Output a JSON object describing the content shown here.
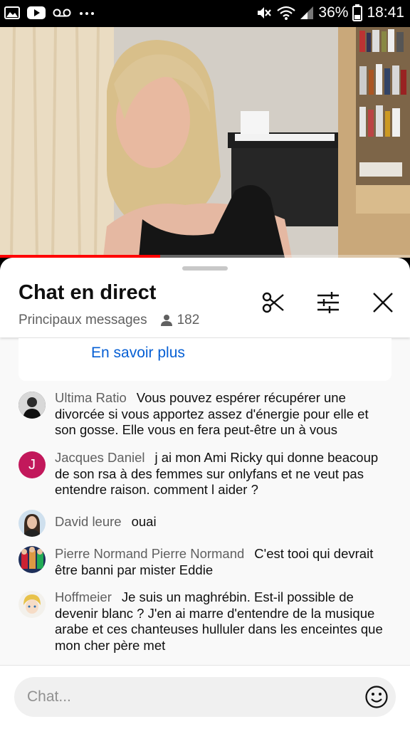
{
  "status_bar": {
    "left_icons": [
      "gallery-icon",
      "youtube-icon",
      "voicemail-icon",
      "more-dots-icon"
    ],
    "battery": "36%",
    "time": "18:41"
  },
  "video": {
    "progress_fraction": 0.39
  },
  "chat": {
    "title": "Chat en direct",
    "mode": "Principaux messages",
    "viewers": "182",
    "info_link": "En savoir plus",
    "input_placeholder": "Chat..."
  },
  "messages": [
    {
      "author": "Ultima Ratio",
      "text": "Vous pouvez espérer récupérer une divorcée si vous apportez assez d'énergie pour elle et son gosse. Elle vous en fera peut-être un à vous",
      "avatar": "photo"
    },
    {
      "author": "Jacques Daniel",
      "text": "j ai mon Ami Ricky qui donne beacoup de son rsa à des femmes sur onlyfans et ne veut pas entendre raison. comment l aider ?",
      "avatar_letter": "J",
      "avatar_color": "#c2185b"
    },
    {
      "author": "David leure",
      "text": "ouai",
      "avatar": "photo"
    },
    {
      "author": "Pierre Normand Pierre Normand",
      "text": "C'est tooi qui devrait être banni par mister Eddie",
      "avatar": "photo"
    },
    {
      "author": "Hoffmeier",
      "text": "Je suis un maghrébin. Est-il possible de devenir blanc ? J'en ai marre d'entendre de la musique arabe et ces chanteuses hulluler dans les enceintes que mon cher père met",
      "avatar": "photo"
    }
  ],
  "colors": {
    "accent_link": "#065fd4",
    "progress": "#ff0000"
  }
}
